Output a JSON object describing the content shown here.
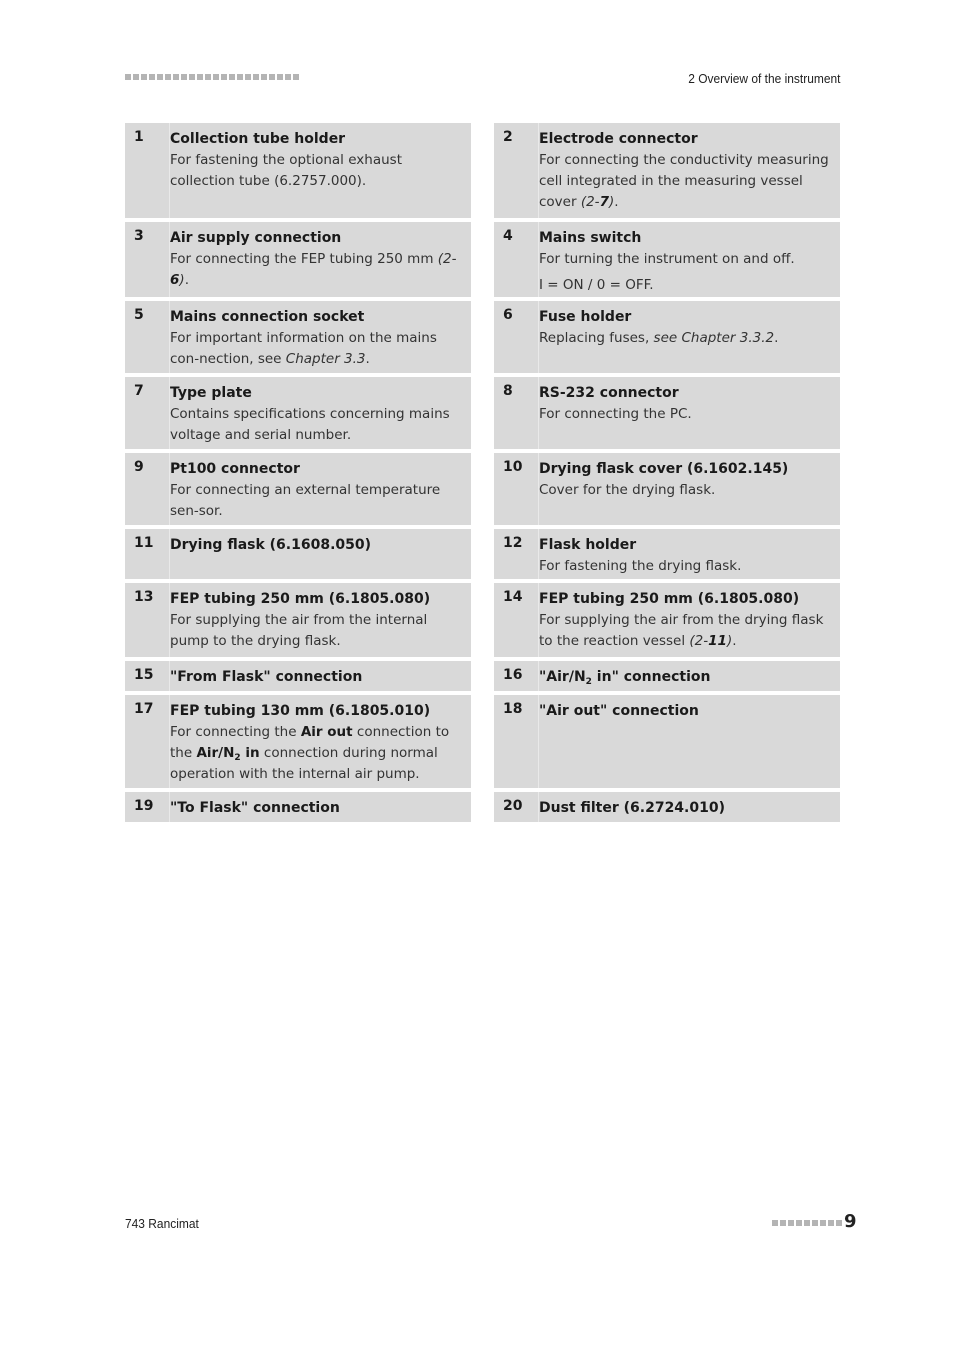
{
  "header": {
    "chapter_title": "2 Overview of the instrument",
    "decorative_squares": 22
  },
  "items": [
    {
      "num": "1",
      "title": "Collection tube holder",
      "desc": [
        [
          {
            "t": "For fastening the optional exhaust collection tube (6.2757.000)."
          }
        ]
      ]
    },
    {
      "num": "2",
      "title": "Electrode connector",
      "desc": [
        [
          {
            "t": "For connecting the conductivity measuring cell integrated in the measuring vessel cover "
          },
          {
            "t": "(2-",
            "s": "ital"
          },
          {
            "t": "7",
            "s": "ital bold"
          },
          {
            "t": ")",
            "s": "ital"
          },
          {
            "t": "."
          }
        ]
      ]
    },
    {
      "num": "3",
      "title": "Air supply connection",
      "desc": [
        [
          {
            "t": "For connecting the FEP tubing 250 mm "
          },
          {
            "t": "(2-",
            "s": "ital"
          },
          {
            "t": "6",
            "s": "ital bold"
          },
          {
            "t": ")",
            "s": "ital"
          },
          {
            "t": "."
          }
        ]
      ]
    },
    {
      "num": "4",
      "title": "Mains switch",
      "desc": [
        [
          {
            "t": "For turning the instrument on and off."
          }
        ],
        [
          {
            "t": "I = ON / 0 = OFF."
          }
        ]
      ]
    },
    {
      "num": "5",
      "title": "Mains connection socket",
      "desc": [
        [
          {
            "t": "For important information on the mains con-nection, see "
          },
          {
            "t": "Chapter 3.3",
            "s": "ital"
          },
          {
            "t": "."
          }
        ]
      ]
    },
    {
      "num": "6",
      "title": "Fuse holder",
      "desc": [
        [
          {
            "t": "Replacing fuses, "
          },
          {
            "t": "see Chapter 3.3.2",
            "s": "ital"
          },
          {
            "t": "."
          }
        ]
      ]
    },
    {
      "num": "7",
      "title": "Type plate",
      "desc": [
        [
          {
            "t": "Contains specifications concerning mains voltage and serial number."
          }
        ]
      ]
    },
    {
      "num": "8",
      "title": "RS-232 connector",
      "desc": [
        [
          {
            "t": "For connecting the PC."
          }
        ]
      ]
    },
    {
      "num": "9",
      "title": "Pt100 connector",
      "desc": [
        [
          {
            "t": "For connecting an external temperature sen-sor."
          }
        ]
      ]
    },
    {
      "num": "10",
      "title": "Drying flask cover (6.1602.145)",
      "desc": [
        [
          {
            "t": "Cover for the drying flask."
          }
        ]
      ]
    },
    {
      "num": "11",
      "title": "Drying flask (6.1608.050)",
      "desc": []
    },
    {
      "num": "12",
      "title": "Flask holder",
      "desc": [
        [
          {
            "t": "For fastening the drying flask."
          }
        ]
      ]
    },
    {
      "num": "13",
      "title": "FEP tubing 250 mm (6.1805.080)",
      "desc": [
        [
          {
            "t": "For supplying the air from the internal pump to the drying flask."
          }
        ]
      ]
    },
    {
      "num": "14",
      "title": "FEP tubing 250 mm (6.1805.080)",
      "desc": [
        [
          {
            "t": "For supplying the air from the drying flask to the reaction vessel "
          },
          {
            "t": "(2-",
            "s": "ital"
          },
          {
            "t": "11",
            "s": "ital bold"
          },
          {
            "t": ")",
            "s": "ital"
          },
          {
            "t": "."
          }
        ]
      ]
    },
    {
      "num": "15",
      "title": "\"From Flask\" connection",
      "desc": []
    },
    {
      "num": "16",
      "title": "\"Air/N|2| in\" connection",
      "desc": []
    },
    {
      "num": "17",
      "title": "FEP tubing 130 mm (6.1805.010)",
      "desc": [
        [
          {
            "t": "For connecting the "
          },
          {
            "t": "Air out",
            "s": "bold"
          },
          {
            "t": " connection to the "
          },
          {
            "t": "Air/N|2| in",
            "s": "bold"
          },
          {
            "t": " connection during normal operation with the internal air pump."
          }
        ]
      ]
    },
    {
      "num": "18",
      "title": "\"Air out\" connection",
      "desc": []
    },
    {
      "num": "19",
      "title": "\"To Flask\" connection",
      "desc": []
    },
    {
      "num": "20",
      "title": "Dust filter (6.2724.010)",
      "desc": []
    }
  ],
  "footer": {
    "product": "743 Rancimat",
    "page_number": "9",
    "decorative_squares": 9
  }
}
